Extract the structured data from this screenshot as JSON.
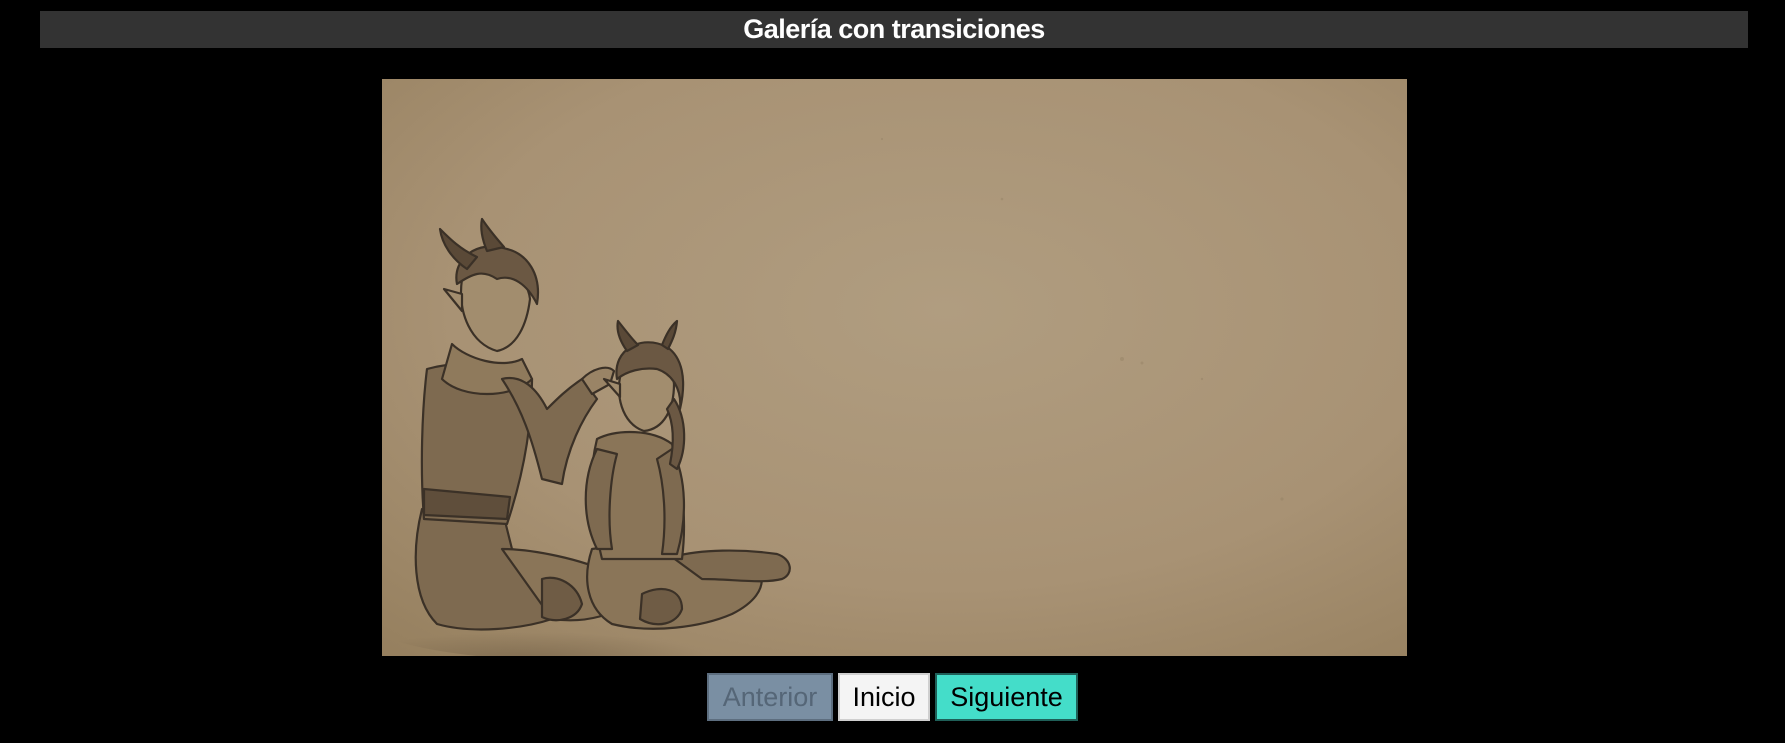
{
  "header": {
    "title": "Galería con transiciones"
  },
  "gallery": {
    "image_subject": "sketch-illustration-two-horned-elves-sitting"
  },
  "controls": {
    "prev_label": "Anterior",
    "home_label": "Inicio",
    "next_label": "Siguiente",
    "prev_disabled": true
  },
  "colors": {
    "background": "#000000",
    "title_bar": "#333333",
    "paper": "#a99476",
    "prev_button": "#7a8fa3",
    "home_button": "#f4f4f4",
    "next_button": "#44ddc9"
  }
}
